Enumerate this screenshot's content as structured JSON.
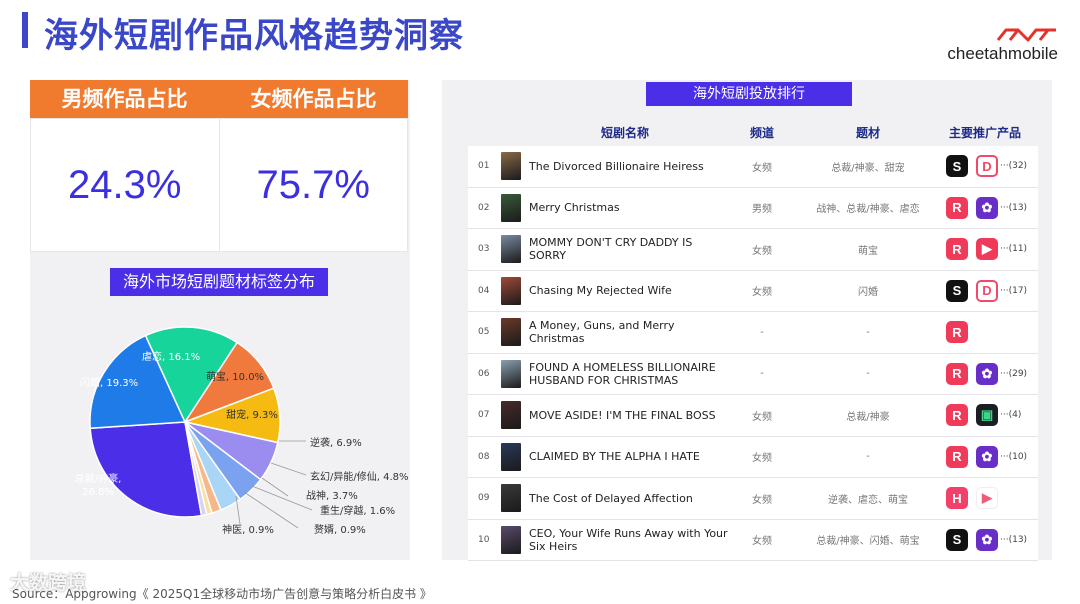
{
  "page_title": "海外短剧作品风格趋势洞察",
  "logo": {
    "text": "cheetahmobile",
    "brand_color": "#e4322b"
  },
  "stats": {
    "male_label": "男频作品占比",
    "female_label": "女频作品占比",
    "male_value": "24.3%",
    "female_value": "75.7%"
  },
  "pie_title": "海外市场短剧题材标签分布",
  "chart_data": {
    "type": "pie",
    "title": "海外市场短剧题材标签分布",
    "slices": [
      {
        "name": "总裁/神豪",
        "value": 26.8,
        "label": "总裁/神豪,\n26.8%",
        "color": "#4a2ee8"
      },
      {
        "name": "闪婚",
        "value": 19.3,
        "label": "闪婚, 19.3%",
        "color": "#1e7be8"
      },
      {
        "name": "虐恋",
        "value": 16.1,
        "label": "虐恋, 16.1%",
        "color": "#17d49a"
      },
      {
        "name": "萌宝",
        "value": 10.0,
        "label": "萌宝, 10.0%",
        "color": "#f07a3e"
      },
      {
        "name": "甜宠",
        "value": 9.3,
        "label": "甜宠, 9.3%",
        "color": "#f5bb12"
      },
      {
        "name": "逆袭",
        "value": 6.9,
        "label": "逆袭, 6.9%",
        "color": "#9b8cf0"
      },
      {
        "name": "玄幻/异能/修仙",
        "value": 4.8,
        "label": "玄幻/异能/修仙, 4.8%",
        "color": "#7aa2ee"
      },
      {
        "name": "战神",
        "value": 3.7,
        "label": "战神, 3.7%",
        "color": "#a9d6f6"
      },
      {
        "name": "重生/穿越",
        "value": 1.6,
        "label": "重生/穿越, 1.6%",
        "color": "#f6b889"
      },
      {
        "name": "赘婿",
        "value": 0.9,
        "label": "赘婿, 0.9%",
        "color": "#f9dfa0"
      },
      {
        "name": "神医",
        "value": 0.9,
        "label": "神医, 0.9%",
        "color": "#d9d2f7"
      }
    ]
  },
  "ranking": {
    "title": "海外短剧投放排行",
    "headers": {
      "name": "短剧名称",
      "channel": "频道",
      "genre": "题材",
      "apps": "主要推广产品"
    },
    "rows": [
      {
        "num": "01",
        "title": "The Divorced Billionaire Heiress",
        "channel": "女频",
        "genre": "总裁/神豪、甜宠",
        "apps": [
          "S",
          "D"
        ],
        "count": "···(32)",
        "thumb": "#8a6a4a"
      },
      {
        "num": "02",
        "title": "Merry Christmas",
        "channel": "男频",
        "genre": "战神、总裁/神豪、虐恋",
        "apps": [
          "R",
          "T"
        ],
        "count": "···(13)",
        "thumb": "#3a5a3a"
      },
      {
        "num": "03",
        "title": "MOMMY DON'T CRY DADDY IS SORRY",
        "channel": "女频",
        "genre": "萌宝",
        "apps": [
          "R",
          "P"
        ],
        "count": "···(11)",
        "thumb": "#7a8aa0"
      },
      {
        "num": "04",
        "title": "Chasing My Rejected Wife",
        "channel": "女频",
        "genre": "闪婚",
        "apps": [
          "S",
          "D"
        ],
        "count": "···(17)",
        "thumb": "#a04a3a"
      },
      {
        "num": "05",
        "title": "A Money, Guns, and Merry Christmas",
        "channel": "-",
        "genre": "-",
        "apps": [
          "R"
        ],
        "count": "",
        "thumb": "#6a3a2a"
      },
      {
        "num": "06",
        "title": "FOUND A HOMELESS BILLIONAIRE HUSBAND FOR CHRISTMAS",
        "channel": "-",
        "genre": "-",
        "apps": [
          "R",
          "T"
        ],
        "count": "···(29)",
        "thumb": "#8aa0b0"
      },
      {
        "num": "07",
        "title": "MOVE ASIDE! I'M THE FINAL BOSS",
        "channel": "女频",
        "genre": "总裁/神豪",
        "apps": [
          "R",
          "G"
        ],
        "count": "···(4)",
        "thumb": "#4a2a2a"
      },
      {
        "num": "08",
        "title": "CLAIMED BY THE ALPHA I HATE",
        "channel": "女频",
        "genre": "-",
        "apps": [
          "R",
          "T"
        ],
        "count": "···(10)",
        "thumb": "#2a3a5a"
      },
      {
        "num": "09",
        "title": "The Cost of Delayed Affection",
        "channel": "女频",
        "genre": "逆袭、虐恋、萌宝",
        "apps": [
          "H",
          "V"
        ],
        "count": "",
        "thumb": "#3a3a3a"
      },
      {
        "num": "10",
        "title": "CEO, Your Wife Runs Away with Your Six Heirs",
        "channel": "女频",
        "genre": "总裁/神豪、闪婚、萌宝",
        "apps": [
          "S",
          "T"
        ],
        "count": "···(13)",
        "thumb": "#5a4a6a"
      }
    ]
  },
  "source": "Source：Appgrowing《 2025Q1全球移动市场广告创意与策略分析白皮书 》",
  "watermark": "大数跨境"
}
